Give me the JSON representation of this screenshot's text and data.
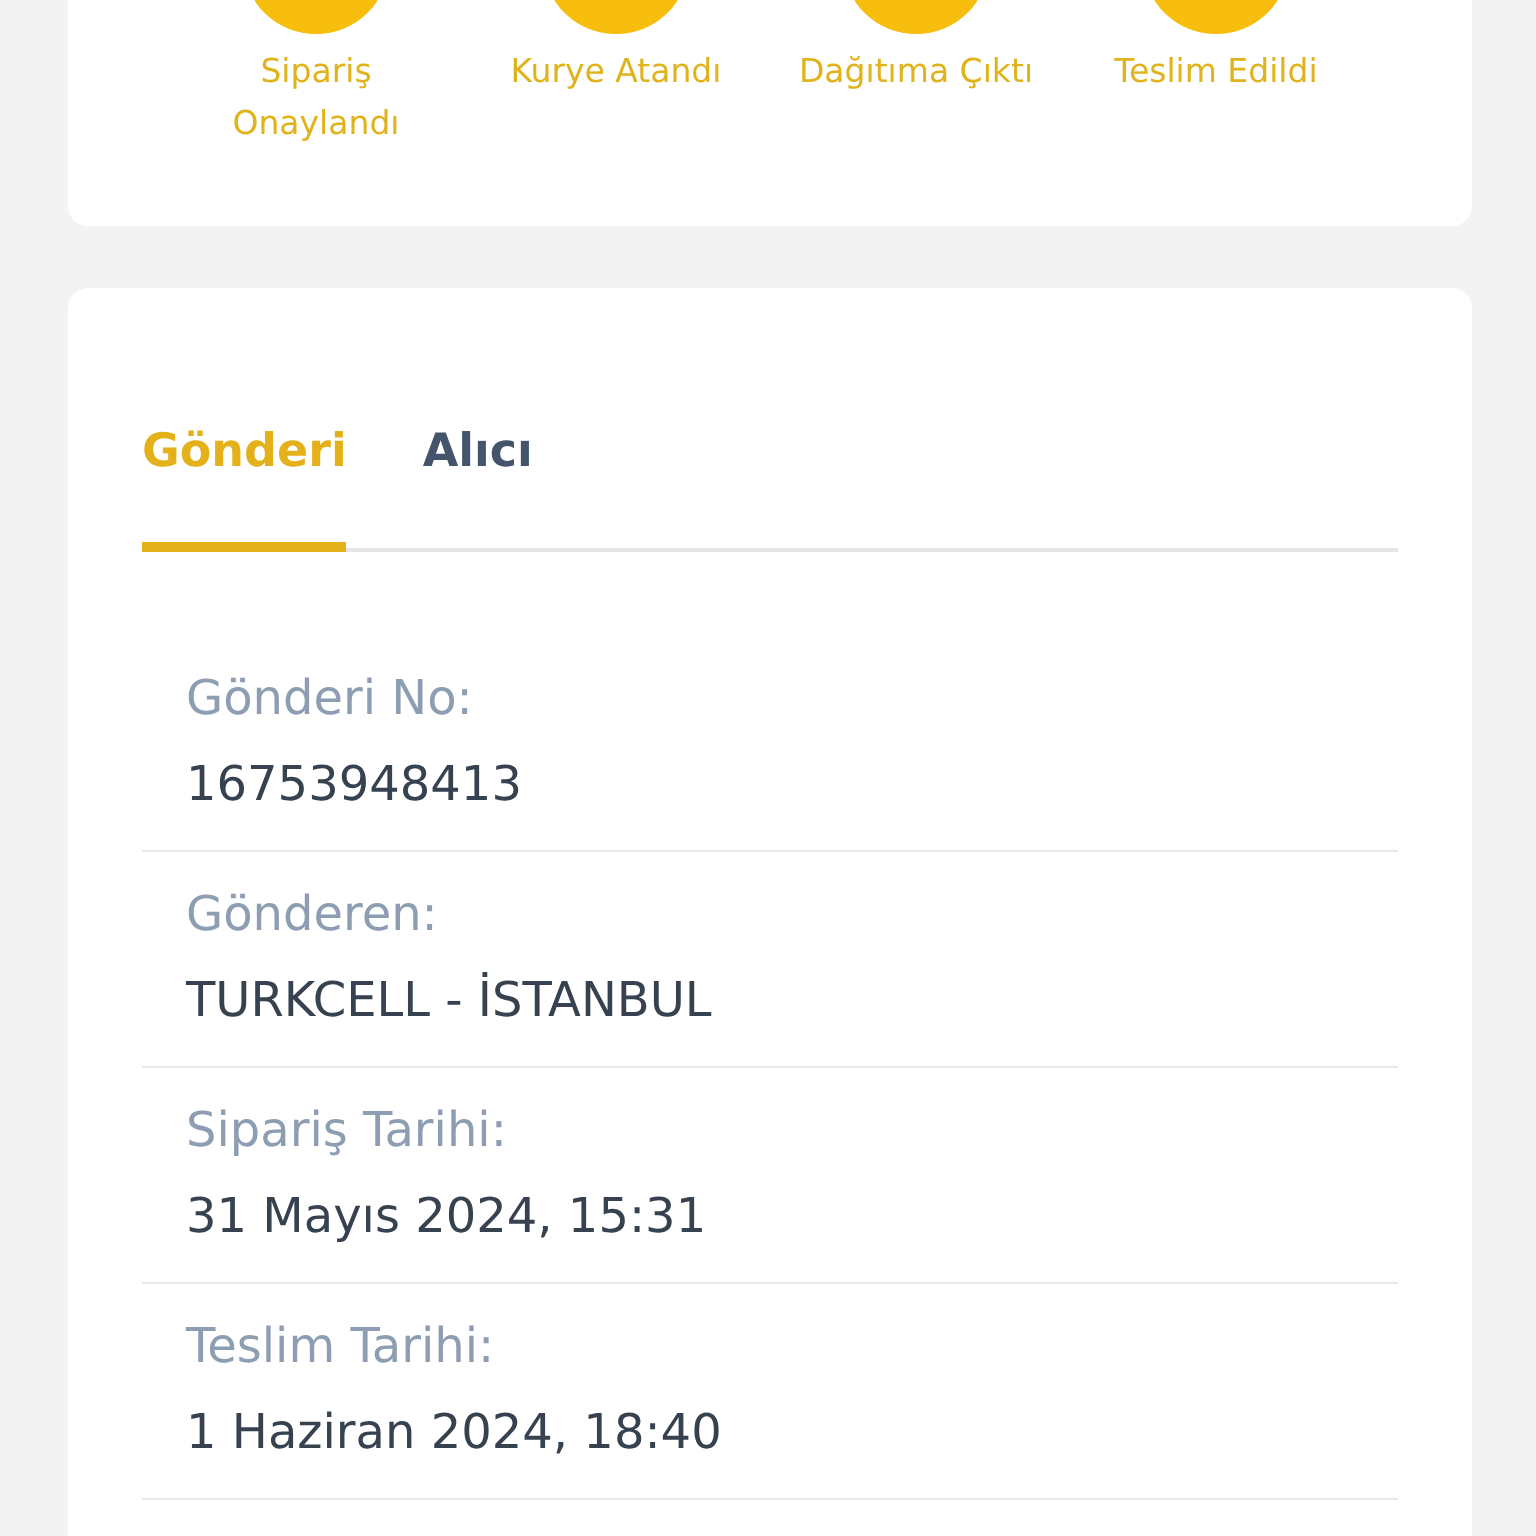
{
  "steps": [
    {
      "label": "Sipariş Onaylandı",
      "done": true
    },
    {
      "label": "Kurye Atandı",
      "done": true
    },
    {
      "label": "Dağıtıma Çıktı",
      "done": true
    },
    {
      "label": "Teslim Edildi",
      "done": true
    }
  ],
  "tabs": [
    {
      "label": "Gönderi",
      "selected": true
    },
    {
      "label": "Alıcı",
      "selected": false
    }
  ],
  "details": [
    {
      "label": "Gönderi No:",
      "value": "16753948413"
    },
    {
      "label": "Gönderen:",
      "value": "TURKCELL - İSTANBUL"
    },
    {
      "label": "Sipariş Tarihi:",
      "value": "31 Mayıs 2024, 15:31"
    },
    {
      "label": "Teslim Tarihi:",
      "value": "1 Haziran 2024, 18:40"
    }
  ]
}
